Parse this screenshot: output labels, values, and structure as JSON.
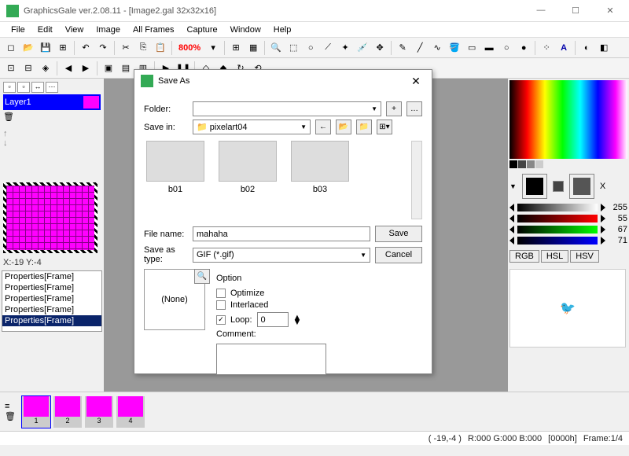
{
  "window": {
    "title": "GraphicsGale ver.2.08.11 - [Image2.gal 32x32x16]"
  },
  "menu": [
    "File",
    "Edit",
    "View",
    "Image",
    "All Frames",
    "Capture",
    "Window",
    "Help"
  ],
  "zoom": "800%",
  "layers": {
    "name": "Layer1"
  },
  "coords": "X:-19 Y:-4",
  "props": [
    "Properties[Frame]",
    "Properties[Frame]",
    "Properties[Frame]",
    "Properties[Frame]",
    "Properties[Frame]"
  ],
  "palette": {
    "sliders": [
      {
        "val": 255
      },
      {
        "val": 55
      },
      {
        "val": 67
      },
      {
        "val": 71
      }
    ],
    "tabs": [
      "RGB",
      "HSL",
      "HSV"
    ]
  },
  "frames": [
    "1",
    "2",
    "3",
    "4"
  ],
  "status": {
    "pos": "( -19,-4 )",
    "rgb": "R:000 G:000 B:000",
    "hex": "[0000h]",
    "frame": "Frame:1/4"
  },
  "dialog": {
    "title": "Save As",
    "folder_label": "Folder:",
    "savein_label": "Save in:",
    "savein_value": "pixelart04",
    "files": [
      "b01",
      "b02",
      "b03"
    ],
    "filename_label": "File name:",
    "filename_value": "mahaha",
    "type_label": "Save as type:",
    "type_value": "GIF (*.gif)",
    "save": "Save",
    "cancel": "Cancel",
    "preview": "(None)",
    "option": "Option",
    "optimize": "Optimize",
    "interlaced": "Interlaced",
    "loop": "Loop:",
    "loop_val": "0",
    "comment": "Comment:"
  }
}
